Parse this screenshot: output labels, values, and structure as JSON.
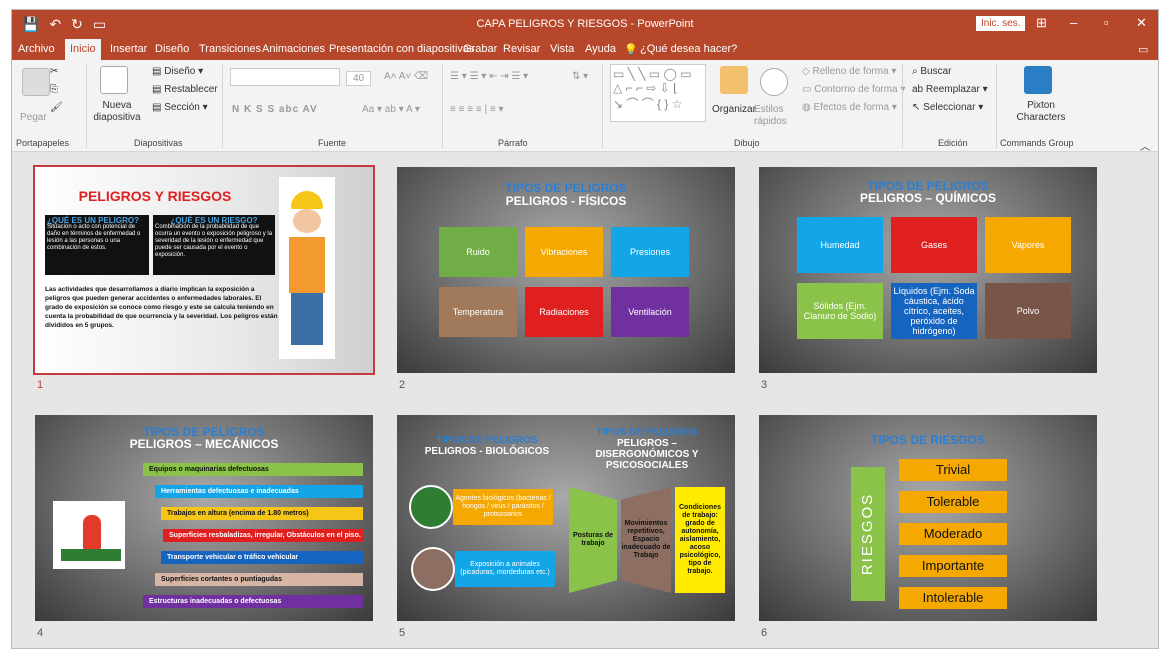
{
  "titlebar": {
    "title": "CAPA PELIGROS Y RIESGOS - PowerPoint",
    "signin": "Inic. ses."
  },
  "menu": [
    "Archivo",
    "Inicio",
    "Insertar",
    "Diseño",
    "Transiciones",
    "Animaciones",
    "Presentación con diapositivas",
    "Grabar",
    "Revisar",
    "Vista",
    "Ayuda"
  ],
  "search_prompt": "¿Qué desea hacer?",
  "ribbon": {
    "groups": [
      "Portapapeles",
      "Diapositivas",
      "Fuente",
      "Párrafo",
      "Dibujo",
      "Edición",
      "Commands Group"
    ],
    "paste": "Pegar",
    "new_slide": "Nueva diapositiva",
    "design": "Diseño",
    "reset": "Restablecer",
    "section": "Sección",
    "font_size": "40",
    "font_buttons": "N  K  S  S  abc  AV",
    "arrange": "Organizar",
    "quick_styles": "Estilos rápidos",
    "fill": "Relleno de forma",
    "outline": "Contorno de forma",
    "effects": "Efectos de forma",
    "find": "Buscar",
    "replace": "Reemplazar",
    "select": "Seleccionar",
    "pixton": "Pixton Characters"
  },
  "slides": [
    {
      "num": "1",
      "title": "PELIGROS Y RIESGOS",
      "q1": "¿QUÉ ES UN PELIGRO?",
      "a1": "Situación o acto con potencial de daño en términos de enfermedad o lesión a las personas o una combinación de estos.",
      "q2": "¿QUÉ ES UN RIESGO?",
      "a2": "Combinación de la probabilidad de que ocurra un evento o exposición peligroso y la severidad de la lesión o enfermedad que puede ser causada por el evento o exposición.",
      "body": "Las actividades que desarrollamos a diario implican la exposición a peligros que pueden generar accidentes o enfermedades laborales. El grado de exposición se conoce como riesgo y este se calcula teniendo en cuenta la probabilidad de que ocurrencia y la severidad. Los peligros están divididos en 5 grupos."
    },
    {
      "num": "2",
      "title": "TIPOS DE PELIGROS",
      "subtitle": "PELIGROS - FÍSICOS",
      "boxes": [
        "Ruido",
        "Vibraciones",
        "Presiones",
        "Temperatura",
        "Radiaciones",
        "Ventilación"
      ]
    },
    {
      "num": "3",
      "title": "TIPOS DE PELIGROS",
      "subtitle": "PELIGROS – QUÍMICOS",
      "boxes": [
        "Humedad",
        "Gases",
        "Vapores",
        "Sólidos (Ejm. Cianuro de Sodio)",
        "Líquidos (Ejm. Soda cáustica, ácido cítrico, aceites, peróxido de hidrógeno)",
        "Polvo"
      ]
    },
    {
      "num": "4",
      "title": "TIPOS DE PELIGROS",
      "subtitle": "PELIGROS – MECÁNICOS",
      "items": [
        "Equipos o maquinarias defectuosas",
        "Herramientas defectuosas e inadecuadas",
        "Trabajos en altura (encima de 1.80 metros)",
        "Superficies resbaladizas, irregular, Obstáculos en el piso.",
        "Transporte vehicular o tráfico vehicular",
        "Superficies cortantes o puntiagudas",
        "Estructuras inadecuadas o defectuosas"
      ]
    },
    {
      "num": "5",
      "title1": "TIPOS DE PELIGROS",
      "subtitle1": "PELIGROS - BIOLÓGICOS",
      "bio": [
        "Agentes biológicos (bacterias / hongos / virus / parásitos / protozoarios",
        "Exposición a animales (picaduras, mordeduras etc.)"
      ],
      "title2": "TIPOS DE PELIGROS",
      "subtitle2": "PELIGROS – DISERGONÓMICOS Y PSICOSOCIALES",
      "ergo": [
        "Posturas de trabajo",
        "Movimientos repetitivos, Espacio inadecuado de Trabajo",
        "Condiciones de trabajo: grado de autonomía, aislamiento, acoso psicológico, tipo de trabajo."
      ]
    },
    {
      "num": "6",
      "title": "TIPOS DE RIESGOS",
      "side": "RIESGOS",
      "levels": [
        "Trivial",
        "Tolerable",
        "Moderado",
        "Importante",
        "Intolerable"
      ]
    }
  ],
  "colors": {
    "accent": "#b7472a"
  }
}
